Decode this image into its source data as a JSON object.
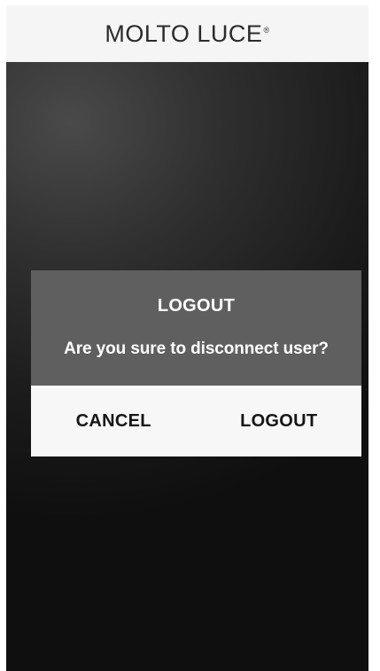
{
  "header": {
    "logo_text": "MOLTO LUCE",
    "logo_mark": "®"
  },
  "dialog": {
    "title": "LOGOUT",
    "message": "Are you sure to disconnect user?",
    "cancel_label": "CANCEL",
    "logout_label": "LOGOUT"
  },
  "colors": {
    "header_bg": "#f5f5f5",
    "dialog_top_bg": "#5f5f5f",
    "dialog_buttons_bg": "#f7f7f7",
    "background_dark": "#1b1b1b"
  }
}
